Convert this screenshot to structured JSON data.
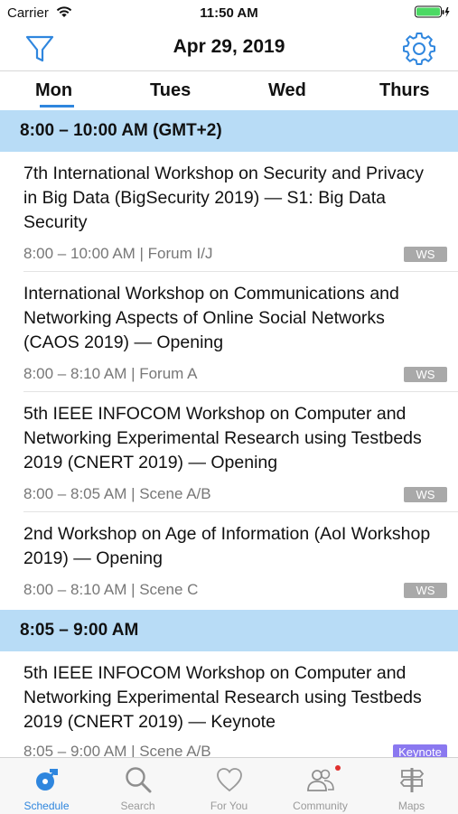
{
  "status_bar": {
    "carrier": "Carrier",
    "time": "11:50 AM"
  },
  "navbar": {
    "title": "Apr 29, 2019"
  },
  "day_tabs": [
    "Mon",
    "Tues",
    "Wed",
    "Thurs"
  ],
  "colors": {
    "accent": "#2f86de",
    "section_bg": "#b8dcf6",
    "badge_ws": "#a9a9a9",
    "badge_keynote": "#8a78f0"
  },
  "sections": [
    {
      "header": "8:00 – 10:00 AM (GMT+2)",
      "events": [
        {
          "title": "7th International Workshop on Security and Privacy in Big Data (BigSecurity 2019) — S1: Big Data Security",
          "meta": "8:00 – 10:00 AM | Forum I/J",
          "badge": "WS"
        },
        {
          "title": "International Workshop on Communications and Networking Aspects of Online Social Networks (CAOS 2019) — Opening",
          "meta": "8:00 – 8:10 AM | Forum A",
          "badge": "WS"
        },
        {
          "title": "5th IEEE INFOCOM Workshop on Computer and Networking Experimental Research using Testbeds 2019 (CNERT 2019) — Opening",
          "meta": "8:00 – 8:05 AM | Scene A/B",
          "badge": "WS"
        },
        {
          "title": "2nd Workshop on Age of Information (AoI Workshop 2019) — Opening",
          "meta": "8:00 – 8:10 AM | Scene C",
          "badge": "WS"
        }
      ]
    },
    {
      "header": "8:05 – 9:00 AM",
      "events": [
        {
          "title": "5th IEEE INFOCOM Workshop on Computer and Networking Experimental Research using Testbeds 2019 (CNERT 2019) — Keynote",
          "meta": "8:05 – 9:00 AM | Scene A/B",
          "badge": "Keynote"
        }
      ]
    }
  ],
  "tab_bar": [
    {
      "label": "Schedule",
      "icon": "schedule-icon"
    },
    {
      "label": "Search",
      "icon": "search-icon"
    },
    {
      "label": "For You",
      "icon": "heart-icon"
    },
    {
      "label": "Community",
      "icon": "community-icon"
    },
    {
      "label": "Maps",
      "icon": "signpost-icon"
    }
  ]
}
